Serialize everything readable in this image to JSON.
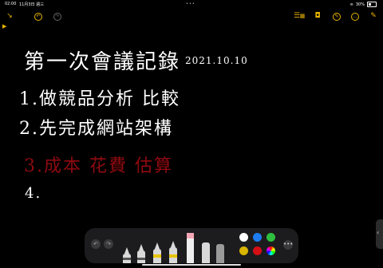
{
  "status": {
    "time": "02:00",
    "date": "11月3日 週三",
    "battery": "30%"
  },
  "toolbar": {
    "left": [
      {
        "name": "collapse-icon",
        "glyph": "↘"
      },
      {
        "name": "undo-circle-icon",
        "glyph": "↶"
      },
      {
        "name": "redo-circle-icon",
        "glyph": "↷"
      }
    ],
    "right": [
      {
        "name": "checklist-icon",
        "glyph": "☰"
      },
      {
        "name": "table-icon",
        "glyph": "▦"
      },
      {
        "name": "camera-icon",
        "glyph": "◘"
      },
      {
        "name": "markup-icon",
        "glyph": "✎"
      },
      {
        "name": "more-icon",
        "glyph": "…"
      },
      {
        "name": "compose-icon",
        "glyph": "✎"
      }
    ]
  },
  "note": {
    "title": "第一次會議記錄",
    "date": "2021.10.10",
    "items": [
      "1.做競品分析 比較",
      "2.先完成網站架構",
      "3.成本 花費 估算",
      "4."
    ]
  },
  "palette": {
    "undo_glyph": "↶",
    "redo_glyph": "↷",
    "more_glyph": "•••",
    "colors": [
      "#ffffff",
      "#1e7cf2",
      "#2fbf3f",
      "#d9b400",
      "#d50f16",
      "#cccccc"
    ]
  }
}
